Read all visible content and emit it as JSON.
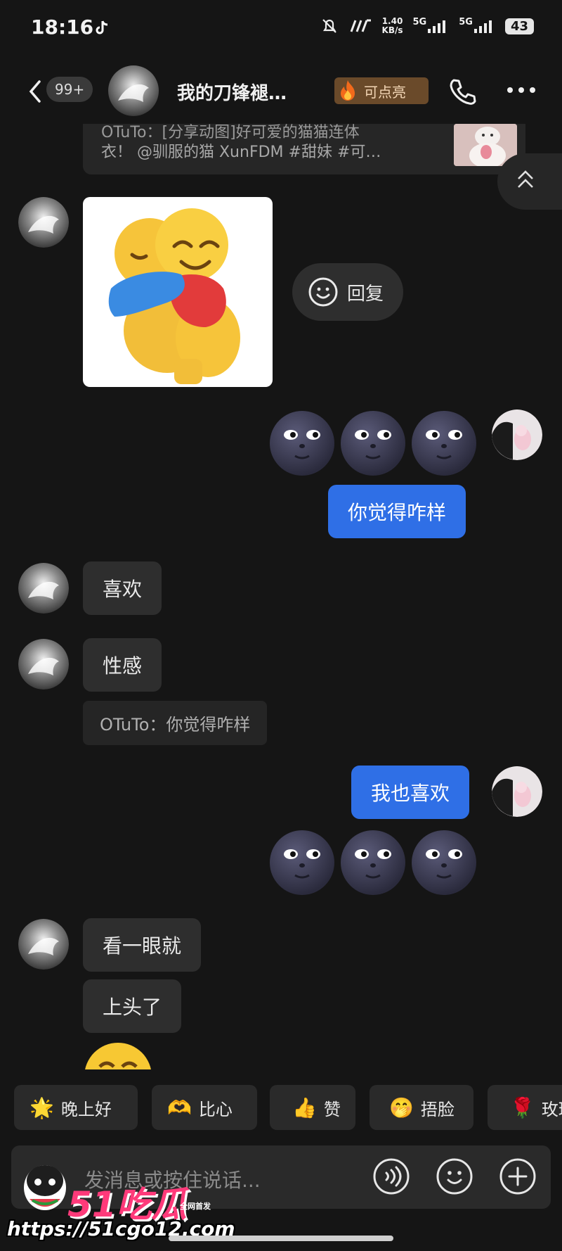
{
  "status_bar": {
    "time": "18:16",
    "network_speed_value": "1.40",
    "network_speed_unit": "KB/s",
    "signal_1": "5G",
    "signal_2": "5G",
    "battery": "43"
  },
  "header": {
    "unread_count": "99+",
    "title": "我的刀锋褪…",
    "streak_label": "可点亮"
  },
  "quoted_post": {
    "line1": "OTuTo：[分享动图]好可爱的猫猫连体",
    "line2": "衣！ @驯服的猫 XunFDM #甜妹 #可…"
  },
  "reply_button_label": "回复",
  "messages": {
    "out_1": "你觉得咋样",
    "in_1": "喜欢",
    "in_2": "性感",
    "quote_ref": "OTuTo：你觉得咋样",
    "out_2": "我也喜欢",
    "in_3": "看一眼就",
    "in_4": "上头了"
  },
  "quick_replies": [
    {
      "emoji": "🌟",
      "label": "晚上好"
    },
    {
      "emoji": "🫶",
      "label": "比心"
    },
    {
      "emoji": "👍",
      "label": "赞"
    },
    {
      "emoji": "🤭",
      "label": "捂脸"
    },
    {
      "emoji": "🌹",
      "label": "玫瑰"
    }
  ],
  "input": {
    "placeholder": "发消息或按住说话..."
  },
  "watermark": {
    "logo": "51吃瓜",
    "tag": "全网首发",
    "url": "https://51cgo12.com"
  },
  "colors": {
    "background": "#151515",
    "outgoing_bubble": "#2f6fe6",
    "incoming_bubble": "#2e2e2e",
    "streak_badge": "#6a4a2a"
  },
  "icons": [
    "back-arrow-icon",
    "flame-icon",
    "phone-icon",
    "more-dots-icon",
    "chevron-up-icon",
    "smiley-icon",
    "voice-icon",
    "emoji-icon",
    "plus-icon"
  ]
}
